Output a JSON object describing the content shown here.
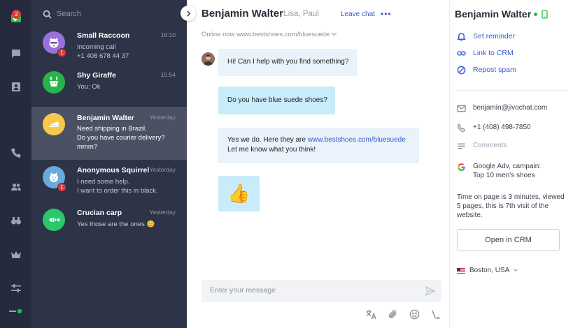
{
  "rail": {
    "badge_count": "2"
  },
  "search": {
    "placeholder": "Search"
  },
  "chats": [
    {
      "name": "Small Raccoon",
      "time": "16:10",
      "line1": "Incoming call",
      "line2": "+1 408 678 44 37",
      "line3": "",
      "badge": "1",
      "avatar_color": "#9b6fdb"
    },
    {
      "name": "Shy Giraffe",
      "time": "15:54",
      "line1": "You: Ok",
      "line2": "",
      "line3": "",
      "badge": "",
      "avatar_color": "#2bb34b"
    },
    {
      "name": "Benjamin Walter",
      "time": "Yesterday",
      "line1": "Need shipping in Brazil.",
      "line2": "Do you have courier delivery?",
      "line3": "mmm?",
      "badge": "",
      "avatar_color": "#f6c84c"
    },
    {
      "name": "Anonymous Squirrel",
      "time": "Yesterday",
      "line1": "I need some help.",
      "line2": "I want to order this in black.",
      "line3": "",
      "badge": "1",
      "avatar_color": "#6aa9dc"
    },
    {
      "name": "Crucian carp",
      "time": "Yesterday",
      "line1": "Yes those are the ones 😊",
      "line2": "",
      "line3": "",
      "badge": "",
      "avatar_color": "#2bc76a"
    }
  ],
  "conversation": {
    "contact_name": "Benjamin Walter",
    "participants": ", Lisa, Paul",
    "leave_label": "Leave chat",
    "more_label": "•••",
    "status": "Online now www.bestshoes.com/bluesuede",
    "messages": {
      "m1": "Hi! Can I help with you find something?",
      "m2": "Do you have blue suede shoes?",
      "m3_prefix": "Yes we do. Here they are ",
      "m3_link": "www.bestshoes.com/bluesuede",
      "m3_line2": "Let me know what you think!",
      "m4": "👍"
    },
    "input_placeholder": "Enter your message"
  },
  "profile": {
    "name": "Benjamin Walter",
    "actions": {
      "reminder": "Set reminder",
      "crm_link": "Link to CRM",
      "spam": "Repost spam"
    },
    "email": "benjamin@jivochat.com",
    "phone": "+1 (408) 498-7850",
    "comments": "Comments",
    "source_line1": "Google Adv, campain:",
    "source_line2": "Top 10 men's shoes",
    "visit_info": "Time on page is 3 minutes, viewed 5 pages, this is 7th visit of the website.",
    "crm_button": "Open in CRM",
    "location": "Boston, USA"
  },
  "colors": {
    "rail_bg": "#252b3d",
    "list_bg": "#2e3447",
    "active_item": "#4b5163",
    "accent": "#3a5bd0",
    "online": "#1fbf4a",
    "badge": "#e0383e"
  }
}
